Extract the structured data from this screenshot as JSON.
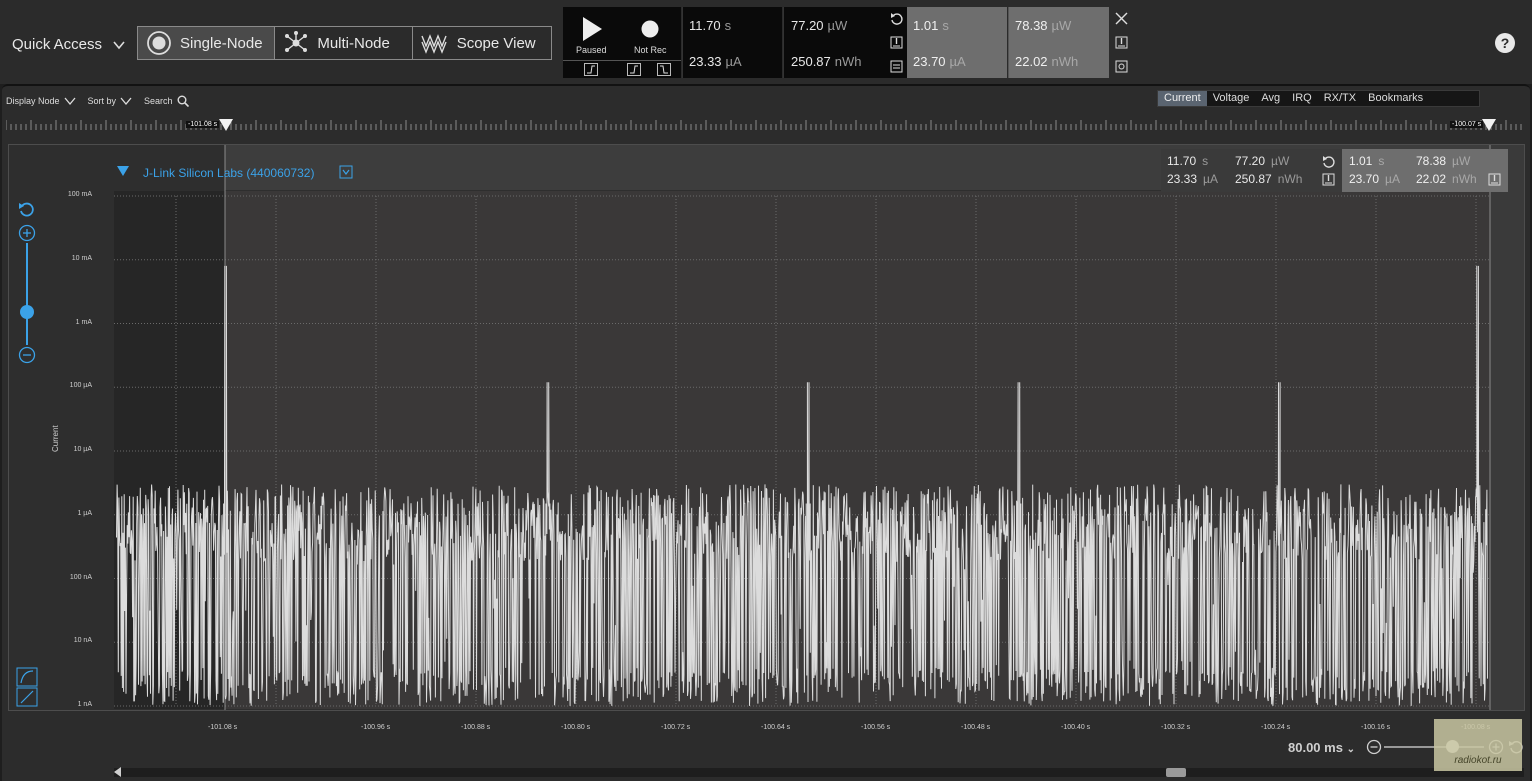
{
  "quick_access": {
    "label": "Quick Access"
  },
  "modes": [
    {
      "label": "Single-Node",
      "icon": "single-node-icon",
      "active": true
    },
    {
      "label": "Multi-Node",
      "icon": "multi-node-icon",
      "active": false
    },
    {
      "label": "Scope View",
      "icon": "scope-view-icon",
      "active": false
    }
  ],
  "controls": {
    "play_label": "Paused",
    "rec_label": "Not Rec"
  },
  "measurements": {
    "time": {
      "value": "11.70",
      "unit": "s"
    },
    "avg_current": {
      "value": "23.33",
      "unit": "µA"
    },
    "avg_power": {
      "value": "77.20",
      "unit": "µW"
    },
    "energy": {
      "value": "250.87",
      "unit": "nWh"
    }
  },
  "selection": {
    "time": {
      "value": "1.01",
      "unit": "s"
    },
    "avg_current": {
      "value": "23.70",
      "unit": "µA"
    },
    "avg_power": {
      "value": "78.38",
      "unit": "µW"
    },
    "energy": {
      "value": "22.02",
      "unit": "nWh"
    }
  },
  "toolbar": {
    "display_node": "Display Node",
    "sort_by": "Sort by",
    "search": "Search"
  },
  "tabs": [
    {
      "label": "Current",
      "active": true
    },
    {
      "label": "Voltage",
      "active": false
    },
    {
      "label": "Avg",
      "active": false
    },
    {
      "label": "IRQ",
      "active": false
    },
    {
      "label": "RX/TX",
      "active": false
    },
    {
      "label": "Bookmarks",
      "active": false
    }
  ],
  "markers": {
    "left": "-101.08 s",
    "right": "-100.07 s"
  },
  "node": {
    "name": "J-Link Silicon Labs (440060732)"
  },
  "plot_colors": {
    "trace": "#dcdcdc",
    "accent": "#3ba2e8"
  },
  "chart_data": {
    "type": "line",
    "title": "",
    "ylabel": "Current",
    "xlabel": "",
    "y_scale": "log",
    "y_ticks": [
      "100 mA",
      "10 mA",
      "1 mA",
      "100 µA",
      "10 µA",
      "1 µA",
      "100 nA",
      "10 nA",
      "1 nA"
    ],
    "x_ticks": [
      "-101.08 s",
      "-100.96 s",
      "-100.88 s",
      "-100.80 s",
      "-100.72 s",
      "-100.64 s",
      "-100.56 s",
      "-100.48 s",
      "-100.40 s",
      "-100.32 s",
      "-100.24 s",
      "-100.16 s",
      "-100.08 s"
    ],
    "xlim": [
      -101.16,
      -100.05
    ],
    "grid": true,
    "series": [
      {
        "spikes": [
          {
            "x": -101.07,
            "y_amps": 0.008
          },
          {
            "x": -100.81,
            "y_amps": 0.00012
          },
          {
            "x": -100.6,
            "y_amps": 0.00012
          },
          {
            "x": -100.43,
            "y_amps": 0.00012
          },
          {
            "x": -100.22,
            "y_amps": 0.00012
          },
          {
            "x": -100.06,
            "y_amps": 0.008
          }
        ],
        "baseline_amps_range": [
          1e-09,
          3e-06
        ]
      }
    ]
  },
  "zoom": {
    "scale_label": "80.00 ms"
  },
  "watermark": {
    "text": "radiokot.ru"
  }
}
